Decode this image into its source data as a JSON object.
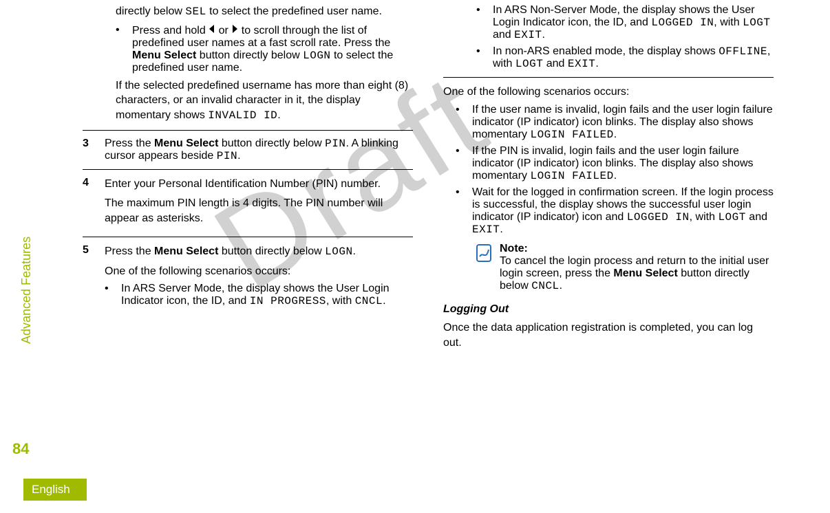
{
  "sidebar": {
    "section_label": "Advanced Features",
    "page_number": "84",
    "language": "English"
  },
  "watermark": "Draft",
  "col1": {
    "intro_fragment_a": "directly below ",
    "intro_code": "SEL",
    "intro_fragment_b": " to select the predefined user name.",
    "bullet_a1": "Press and hold ",
    "bullet_a2": " or ",
    "bullet_a3": " to scroll through the list of predefined user names at a fast scroll rate. Press the ",
    "bullet_a_bold": "Menu Select",
    "bullet_a4": " button directly below ",
    "bullet_a_code": "LOGN",
    "bullet_a5": " to select the predefined user name.",
    "para_b1": "If the selected predefined username has more than eight (8) characters, or an invalid character in it, the display momentary shows ",
    "para_b_code": "INVALID ID",
    "para_b2": ".",
    "step3_num": "3",
    "step3_a": "Press the ",
    "step3_bold": "Menu Select",
    "step3_b": " button directly below ",
    "step3_code1": "PIN",
    "step3_c": ". A blinking cursor appears beside ",
    "step3_code2": "PIN",
    "step3_d": ".",
    "step4_num": "4",
    "step4_a": "Enter your Personal Identification Number (PIN) number.",
    "step4_b": "The maximum PIN length is 4 digits. The PIN number will appear as asterisks.",
    "step5_num": "5",
    "step5_a": "Press the ",
    "step5_bold": "Menu Select",
    "step5_b": " button directly below ",
    "step5_code": "LOGN",
    "step5_c": ".",
    "step5_d": "One of the following scenarios occurs:",
    "step5_bullet1_a": "In ARS Server Mode, the display shows the User Login Indicator icon, the ID, and ",
    "step5_bullet1_code1": "IN PROGRESS",
    "step5_bullet1_b": ", with ",
    "step5_bullet1_code2": "CNCL",
    "step5_bullet1_c": "."
  },
  "col2": {
    "bullet1_a": "In ARS Non-Server Mode, the display shows the User Login Indicator icon, the ID, and ",
    "bullet1_code1": "LOGGED IN",
    "bullet1_b": ", with ",
    "bullet1_code2": "LOGT",
    "bullet1_c": " and ",
    "bullet1_code3": "EXIT",
    "bullet1_d": ".",
    "bullet2_a": "In non-ARS enabled mode, the display shows ",
    "bullet2_code1": "OFFLINE",
    "bullet2_b": ", with ",
    "bullet2_code2": "LOGT",
    "bullet2_c": " and ",
    "bullet2_code3": "EXIT",
    "bullet2_d": ".",
    "para_intro": "One of the following scenarios occurs:",
    "sbullet1_a": "If the user name is invalid, login fails and the user login failure indicator (IP indicator) icon blinks. The display also shows momentary ",
    "sbullet1_code": "LOGIN FAILED",
    "sbullet1_b": ".",
    "sbullet2_a": "If the PIN is invalid, login fails and the user login failure indicator (IP indicator) icon blinks. The display also shows momentary ",
    "sbullet2_code": "LOGIN FAILED",
    "sbullet2_b": ".",
    "sbullet3_a": "Wait for the logged in confirmation screen. If the login process is successful, the display shows the successful user login indicator (IP indicator) icon and ",
    "sbullet3_code1": "LOGGED IN",
    "sbullet3_b": ", with ",
    "sbullet3_code2": "LOGT",
    "sbullet3_c": " and ",
    "sbullet3_code3": "EXIT",
    "sbullet3_d": ".",
    "note_label": "Note:",
    "note_a": "To cancel the login process and return to the initial user login screen, press the ",
    "note_bold": "Menu Select",
    "note_b": " button directly below ",
    "note_code": "CNCL",
    "note_c": ".",
    "heading": "Logging Out",
    "closing": "Once the data application registration is completed, you can log out."
  }
}
